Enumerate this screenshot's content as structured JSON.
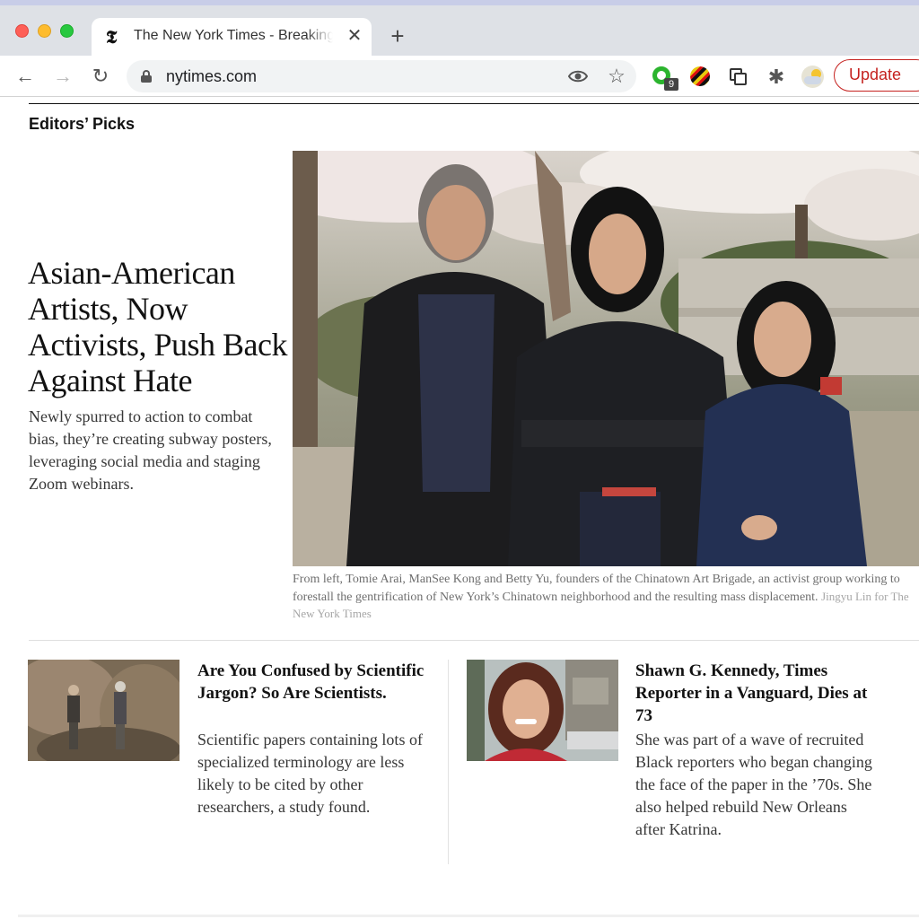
{
  "browser": {
    "tab_favicon": "𝕿",
    "tab_title": "The New York Times - Breaking News",
    "tab_close": "✕",
    "new_tab": "+",
    "url": "nytimes.com",
    "back_icon": "←",
    "forward_icon": "→",
    "reload_icon": "↻",
    "star_icon": "☆",
    "extension_badge": "9",
    "puzzle_icon": "✱",
    "update_label": "Update"
  },
  "section": {
    "title": "Editors’ Picks"
  },
  "lead_story": {
    "headline": "Asian-American Artists, Now Activists, Push Back Against Hate",
    "summary": "Newly spurred to action to combat bias, they’re creating subway posters, leveraging social media and staging Zoom webinars.",
    "caption": "From left, Tomie Arai, ManSee Kong and Betty Yu, founders of the Chinatown Art Brigade, an activist group working to forestall the gentrification of New York’s Chinatown neighborhood and the resulting mass displacement.",
    "credit": "Jingyu Lin for The New York Times"
  },
  "stories": [
    {
      "headline": "Are You Confused by Scientific Jargon? So Are Scientists.",
      "summary": "Scientific papers containing lots of specialized terminology are less likely to be cited by other researchers, a study found."
    },
    {
      "headline": "Shawn G. Kennedy, Times Reporter in a Vanguard, Dies at 73",
      "summary": "She was part of a wave of recruited Black reporters who began changing the face of the paper in the ’70s. She also helped rebuild New Orleans after Katrina."
    }
  ],
  "colors": {
    "update_accent": "#c5221f",
    "text_primary": "#121212",
    "text_secondary": "#363636"
  }
}
